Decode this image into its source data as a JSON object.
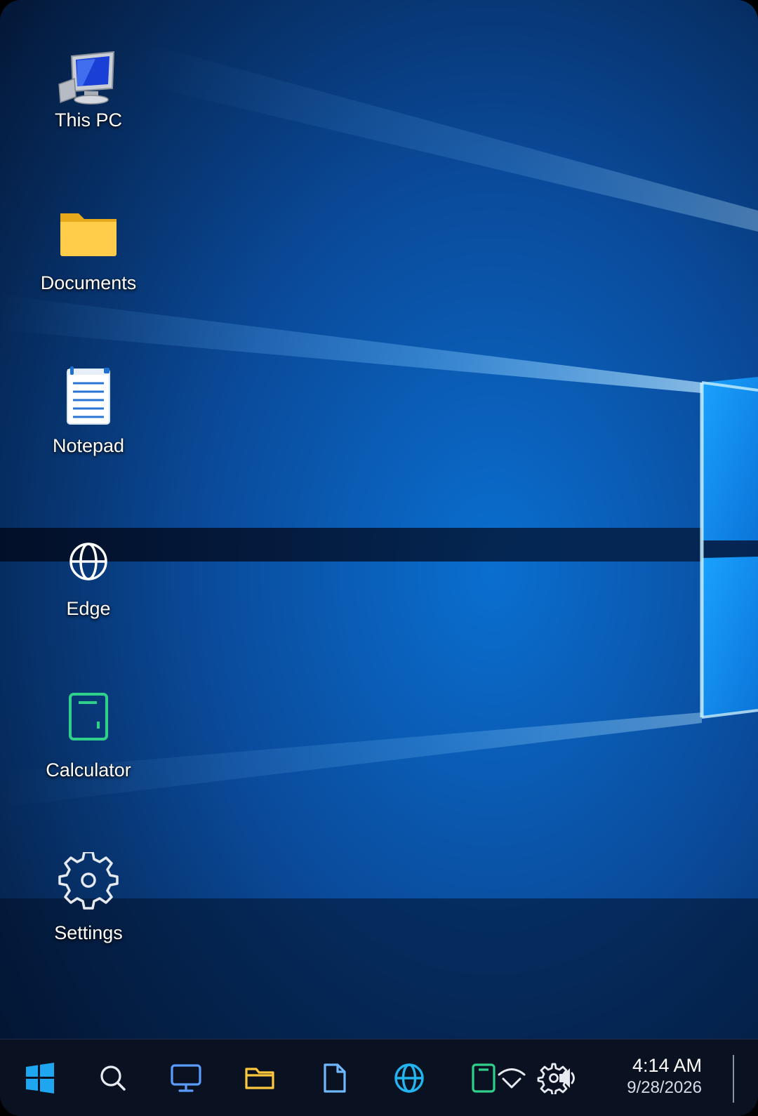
{
  "desktop": {
    "icons": [
      {
        "label": "This PC",
        "icon": "computer-icon"
      },
      {
        "label": "Documents",
        "icon": "folder-icon"
      },
      {
        "label": "Notepad",
        "icon": "notepad-icon"
      },
      {
        "label": "Edge",
        "icon": "globe-icon"
      },
      {
        "label": "Calculator",
        "icon": "calculator-icon"
      },
      {
        "label": "Settings",
        "icon": "gear-icon"
      }
    ]
  },
  "taskbar": {
    "buttons": [
      {
        "icon": "windows-logo-icon"
      },
      {
        "icon": "search-icon"
      },
      {
        "icon": "monitor-icon"
      },
      {
        "icon": "folder-icon"
      },
      {
        "icon": "file-icon"
      },
      {
        "icon": "globe-icon"
      },
      {
        "icon": "calculator-icon"
      }
    ],
    "tray": {
      "wifi": "wifi-icon",
      "settings": "gear-icon",
      "volume": "volume-icon"
    },
    "clock": {
      "time": "4:14 AM",
      "date": "9/28/2026"
    }
  },
  "colors": {
    "accent_blue": "#2fa4e7",
    "folder_yellow": "#ffc83d",
    "calculator_green": "#2fd08a",
    "taskbar_bg": "#0a1120"
  }
}
